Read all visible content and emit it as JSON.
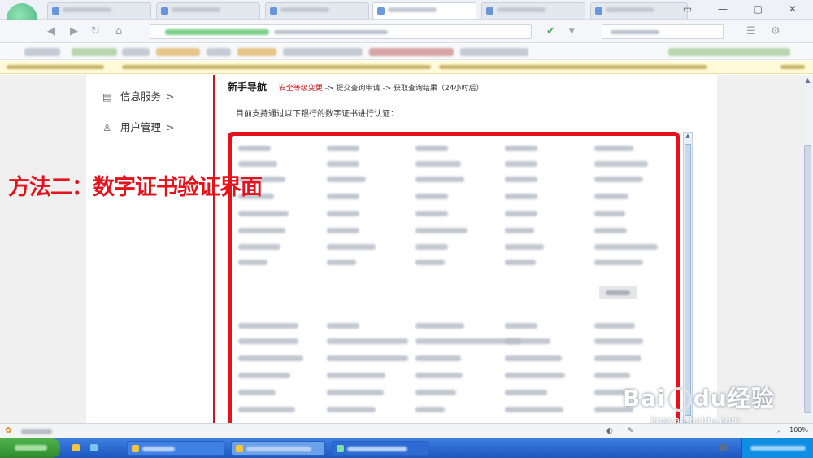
{
  "browser": {
    "tabs_count": 7,
    "window_controls": "▭ — ▢ ✕"
  },
  "sidebar": {
    "items": [
      {
        "label": "信息服务",
        "arrow": ">",
        "icon": "document-icon"
      },
      {
        "label": "用户管理",
        "arrow": ">",
        "icon": "user-icon"
      }
    ]
  },
  "nav": {
    "title": "新手导航",
    "step1": "安全等级变更",
    "sep1": "->",
    "step2": "提交查询申请",
    "sep2": "->",
    "step3": "获取查询结果（",
    "step3_note": "24小时后",
    "step3_end": "）"
  },
  "main": {
    "intro": "目前支持通过以下银行的数字证书进行认证："
  },
  "overlay": {
    "text": "方法二：数字证书验证界面"
  },
  "watermark": {
    "brand_left": "Bai",
    "brand_right": "du",
    "brand_cn": "经验",
    "url": "jingyan.baidu.com"
  },
  "statusbar": {
    "zoom": "100%"
  },
  "colors": {
    "accent_red": "#e4121c",
    "divider_red": "#c8161d",
    "taskbar_blue": "#1d57c0",
    "start_green": "#2d8a2b"
  }
}
